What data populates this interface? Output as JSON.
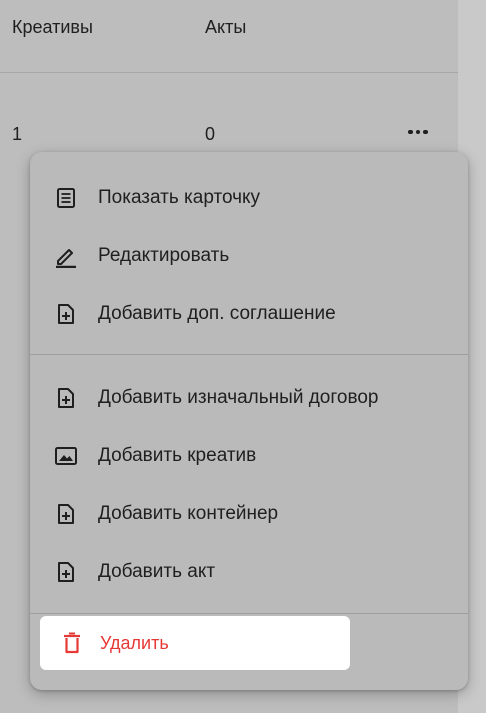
{
  "table": {
    "headers": {
      "creatives": "Креативы",
      "acts": "Акты"
    },
    "row": {
      "creatives": "1",
      "acts": "0"
    }
  },
  "menu": {
    "group1": [
      {
        "label": "Показать карточку",
        "icon": "card-list-icon"
      },
      {
        "label": "Редактировать",
        "icon": "pencil-icon"
      },
      {
        "label": "Добавить доп. соглашение",
        "icon": "add-document-icon"
      }
    ],
    "group2": [
      {
        "label": "Добавить изначальный договор",
        "icon": "add-document-icon"
      },
      {
        "label": "Добавить креатив",
        "icon": "image-icon"
      },
      {
        "label": "Добавить контейнер",
        "icon": "add-document-icon"
      },
      {
        "label": "Добавить акт",
        "icon": "add-document-icon"
      }
    ],
    "delete": {
      "label": "Удалить",
      "icon": "trash-icon"
    }
  },
  "colors": {
    "danger": "#e53935",
    "overlay": "#bdbdbd"
  }
}
